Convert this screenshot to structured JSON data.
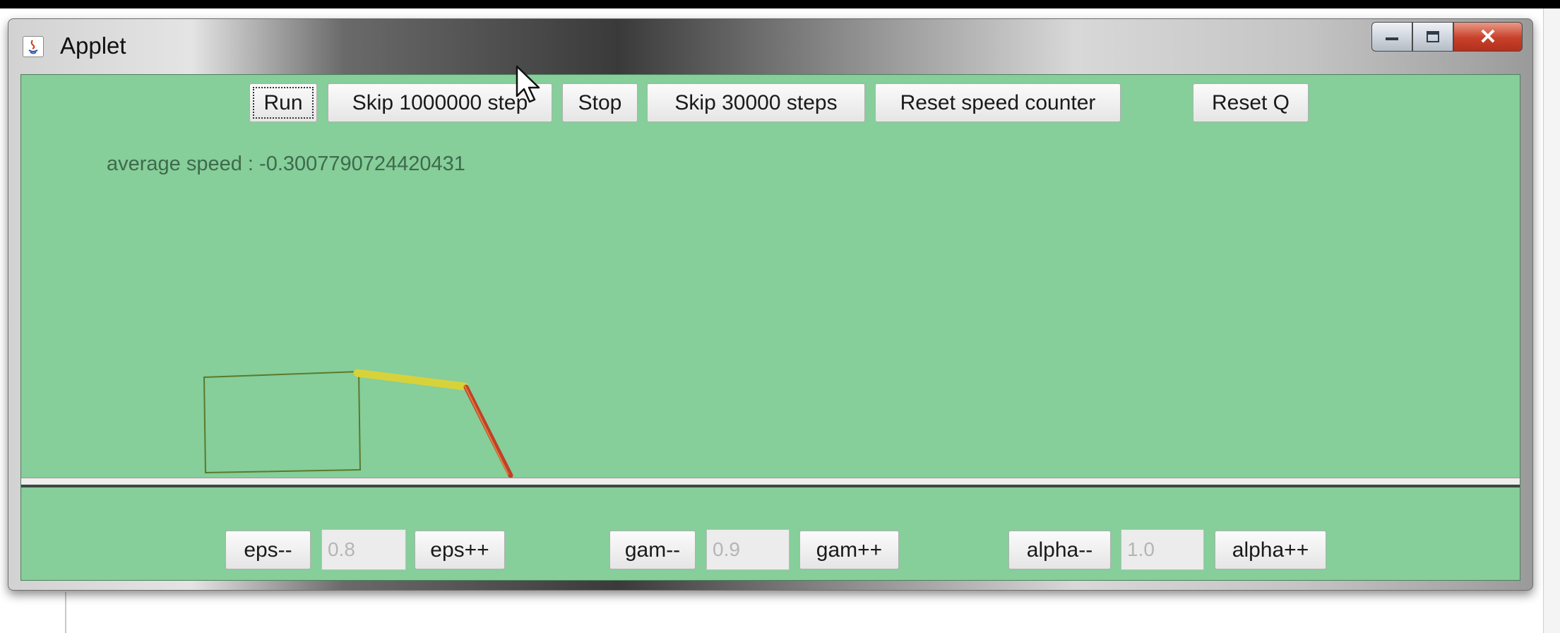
{
  "window": {
    "title": "Applet",
    "controls": {
      "minimize": "minimize",
      "maximize": "maximize",
      "close": "✕"
    }
  },
  "toolbar": {
    "run": "Run",
    "skip_million": "Skip 1000000 step",
    "stop": "Stop",
    "skip_30000": "Skip 30000 steps",
    "reset_speed": "Reset speed counter",
    "reset_q": "Reset Q"
  },
  "status": {
    "average_speed": "average speed : -0.3007790724420431"
  },
  "params": {
    "eps": {
      "dec": "eps--",
      "value": "0.8",
      "inc": "eps++"
    },
    "gam": {
      "dec": "gam--",
      "value": "0.9",
      "inc": "gam++"
    },
    "alpha": {
      "dec": "alpha--",
      "value": "1.0",
      "inc": "alpha++"
    }
  },
  "colors": {
    "canvas_background": "#86ce9a",
    "upper_arm": "#d8d23a",
    "lower_arm": "#c0402a",
    "body_outline": "#5a7a2a"
  }
}
